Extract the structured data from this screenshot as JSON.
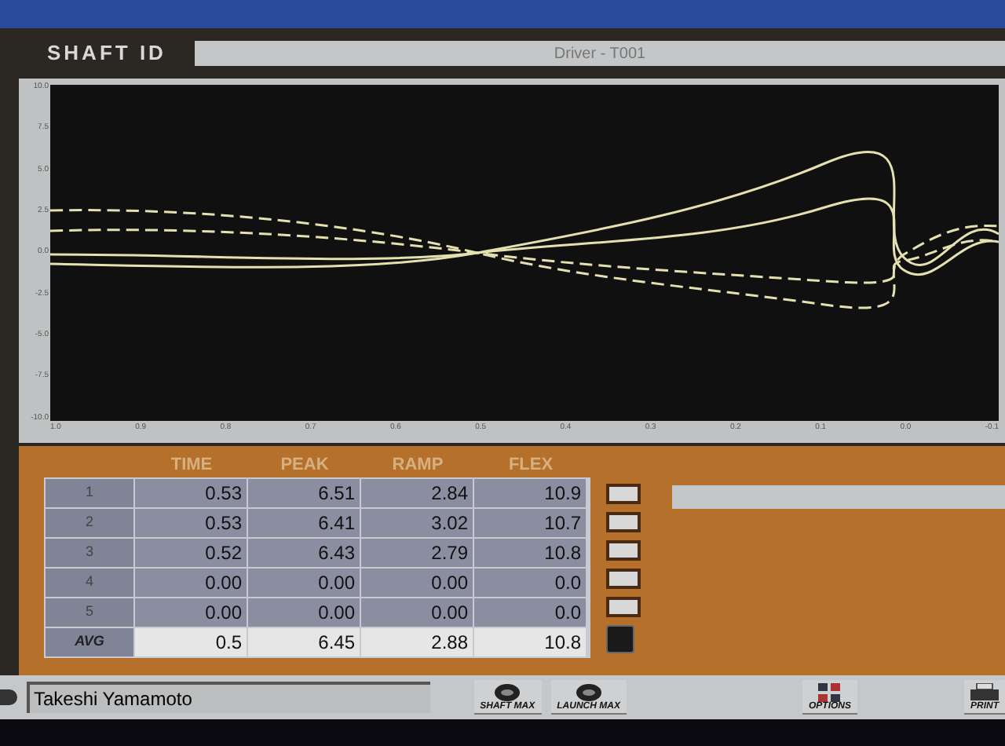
{
  "header": {
    "label": "SHAFT ID",
    "value": "Driver - T001"
  },
  "plot": {
    "y_ticks": [
      "10.0",
      "7.5",
      "5.0",
      "2.5",
      "0.0",
      "-2.5",
      "-5.0",
      "-7.5",
      "-10.0"
    ],
    "x_ticks": [
      "1.0",
      "0.9",
      "0.8",
      "0.7",
      "0.6",
      "0.5",
      "0.4",
      "0.3",
      "0.2",
      "0.1",
      "0.0",
      "-0.1"
    ]
  },
  "table": {
    "columns": [
      "TIME",
      "PEAK",
      "RAMP",
      "FLEX"
    ],
    "rows": [
      {
        "label": "1",
        "cells": [
          "0.53",
          "6.51",
          "2.84",
          "10.9"
        ],
        "kind": "shot",
        "selected": false
      },
      {
        "label": "2",
        "cells": [
          "0.53",
          "6.41",
          "3.02",
          "10.7"
        ],
        "kind": "shot",
        "selected": false
      },
      {
        "label": "3",
        "cells": [
          "0.52",
          "6.43",
          "2.79",
          "10.8"
        ],
        "kind": "shot",
        "selected": false
      },
      {
        "label": "4",
        "cells": [
          "0.00",
          "0.00",
          "0.00",
          "0.0"
        ],
        "kind": "shot",
        "selected": false
      },
      {
        "label": "5",
        "cells": [
          "0.00",
          "0.00",
          "0.00",
          "0.0"
        ],
        "kind": "shot",
        "selected": false
      },
      {
        "label": "AVG",
        "cells": [
          "0.5",
          "6.45",
          "2.88",
          "10.8"
        ],
        "kind": "average",
        "selected": true
      }
    ]
  },
  "player": {
    "value": "Takeshi Yamamoto"
  },
  "buttons": [
    {
      "label": "SHAFT MAX",
      "kind": "disc"
    },
    {
      "label": "LAUNCH MAX",
      "kind": "disc"
    },
    {
      "label": "OPTIONS",
      "kind": "grid"
    },
    {
      "label": "PRINT",
      "kind": "printer"
    }
  ]
}
